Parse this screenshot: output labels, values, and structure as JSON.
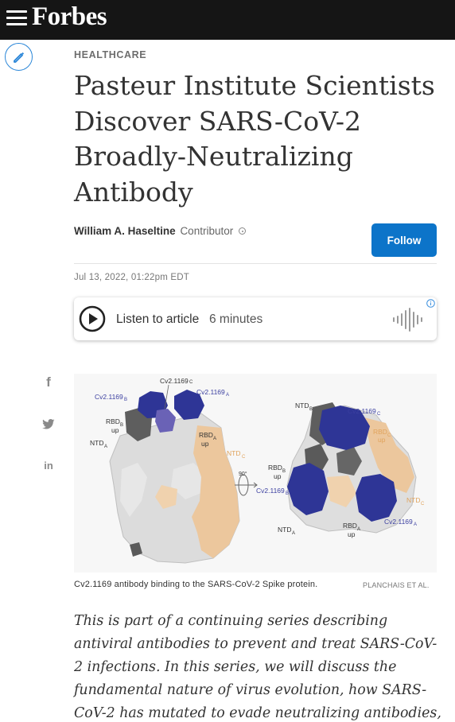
{
  "header": {
    "logo": "Forbes",
    "menu_icon": "hamburger-menu-icon"
  },
  "edit_icon": "pencil-icon",
  "article": {
    "section": "HEALTHCARE",
    "headline": "Pasteur Institute Scientists Discover SARS-CoV-2 Broadly-Neutralizing Antibody",
    "author": "William A. Haseltine",
    "author_role": "Contributor",
    "follow_label": "Follow",
    "date": "Jul 13, 2022, 01:22pm EDT"
  },
  "listen": {
    "label": "Listen to article",
    "duration": "6 minutes",
    "play_icon": "play-icon",
    "wave_icon": "audio-wave-icon"
  },
  "share": {
    "facebook": "f",
    "twitter_icon": "twitter-bird-icon",
    "linkedin": "in"
  },
  "figure": {
    "labels": {
      "cv_c_left": "Cv2.1169",
      "cv_b_left": "Cv2.1169",
      "cv_a_left": "Cv2.1169",
      "rbd_b": "RBD",
      "up": "up",
      "rbd_a": "RBD",
      "ntd_a": "NTD",
      "ntd_c": "NTD",
      "rotation": "90°",
      "ntd_b": "NTD",
      "cv_c_right": "Cv2.1169",
      "rbd_c": "RBD",
      "rbd_b_right": "RBD",
      "cv_b_right": "Cv2.1169",
      "ntd_c_right": "NTD",
      "cv_a_right": "Cv2.1169",
      "rbd_a_right": "RBD",
      "ntd_a_right": "NTD",
      "sub_a": "A",
      "sub_b": "B",
      "sub_c": "C"
    },
    "caption": "Cv2.1169 antibody binding to the SARS-CoV-2 Spike protein.",
    "credit": "PLANCHAIS ET AL."
  },
  "body": {
    "paragraph": "This is part of a continuing series describing antiviral antibodies to prevent and treat SARS-CoV-2 infections. In this series, we will discuss the fundamental nature of virus evolution, how SARS-CoV-2 has mutated to evade neutralizing antibodies, and our latest attempts to fight"
  },
  "colors": {
    "topbar": "#151515",
    "follow": "#0c74c9",
    "antibody": "#2e3596",
    "antibody_light": "#6a62b6",
    "rbd_dark": "#5d5d5d",
    "peach": "#edc9a0",
    "spike_gray": "#d9d9d9"
  }
}
